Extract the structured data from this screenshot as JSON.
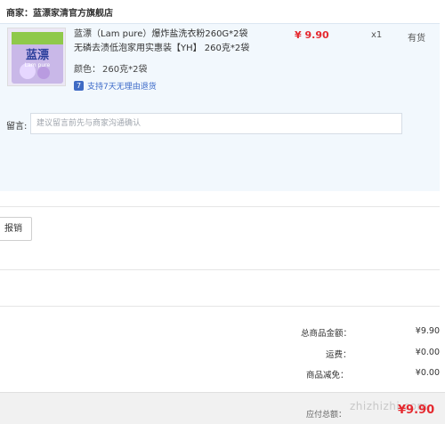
{
  "merchant": {
    "label": "商家：",
    "name": "蓝漂家清官方旗舰店"
  },
  "product": {
    "title": "蓝漂（Lam pure）爆炸盐洗衣粉260G*2袋无磷去渍低泡家用实惠装【YH】 260克*2袋",
    "image_text": "蓝漂",
    "image_brand": "Lam pure",
    "variant_label": "颜色：",
    "variant_value": "260克*2袋",
    "return_policy": "支持7天无理由退货",
    "return_icon": "7",
    "price": "¥ 9.90",
    "quantity": "x1",
    "stock": "有货"
  },
  "message": {
    "label": "留言:",
    "placeholder": "建议留言前先与商家沟通确认"
  },
  "invoice": {
    "button_label": "报销"
  },
  "summary": {
    "goods_total_label": "总商品金额：",
    "goods_total_value": "¥9.90",
    "shipping_label": "运费：",
    "shipping_value": "¥0.00",
    "discount_label": "商品减免：",
    "discount_value": "¥0.00"
  },
  "footer": {
    "payable_label": "应付总额：",
    "payable_value": "¥9.90",
    "watermark": "zhizhizhi.com"
  },
  "colors": {
    "price_red": "#e5292f",
    "panel_bg": "#f2f8fd",
    "link_blue": "#3a68c8"
  }
}
